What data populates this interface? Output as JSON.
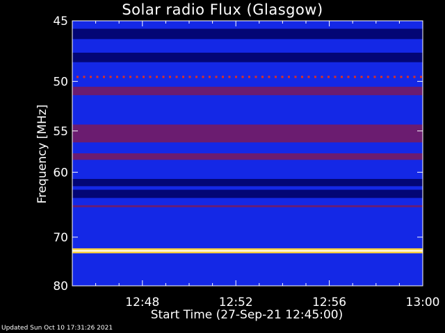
{
  "chart_data": {
    "type": "heatmap",
    "title": "Solar radio Flux (Glasgow)",
    "xlabel": "Start Time (27-Sep-21 12:45:00)",
    "ylabel": "Frequency [MHz]",
    "x_ticks": [
      "12:48",
      "12:52",
      "12:56",
      "13:00"
    ],
    "x_tick_minutes": [
      3,
      7,
      11,
      15
    ],
    "xlim_minutes": [
      0,
      15
    ],
    "y_ticks": [
      45,
      50,
      55,
      60,
      70,
      80
    ],
    "ylim": [
      45,
      80
    ],
    "y_scale": "reciprocal",
    "colors": {
      "background": "#1428e6",
      "dark": "#000060",
      "band": "#7a1a5a",
      "rfi": "#ffd040",
      "rfi_core": "#ffffff"
    },
    "bands": [
      {
        "freq_from": 45.6,
        "freq_to": 46.4,
        "level": "dark"
      },
      {
        "freq_from": 47.5,
        "freq_to": 48.3,
        "level": "dark"
      },
      {
        "freq_from": 49.5,
        "freq_to": 49.7,
        "level": "dotted"
      },
      {
        "freq_from": 50.5,
        "freq_to": 51.3,
        "level": "band"
      },
      {
        "freq_from": 54.3,
        "freq_to": 56.3,
        "level": "band"
      },
      {
        "freq_from": 57.6,
        "freq_to": 58.4,
        "level": "band"
      },
      {
        "freq_from": 60.9,
        "freq_to": 61.9,
        "level": "dark"
      },
      {
        "freq_from": 62.4,
        "freq_to": 63.6,
        "level": "dark"
      },
      {
        "freq_from": 64.7,
        "freq_to": 65.0,
        "level": "band"
      },
      {
        "freq_from": 72.2,
        "freq_to": 72.9,
        "level": "rfi"
      }
    ]
  },
  "footer": "Updated Sun Oct 10 17:31:26 2021"
}
